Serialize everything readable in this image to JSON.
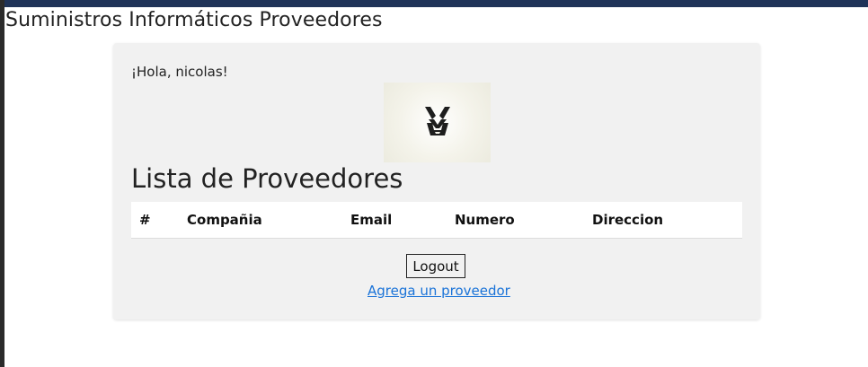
{
  "header": {
    "title": "Suministros Informáticos Proveedores"
  },
  "panel": {
    "greeting": "¡Hola, nicolas!",
    "list_title": "Lista de Proveedores",
    "table": {
      "columns": [
        "#",
        "Compañia",
        "Email",
        "Numero",
        "Direccion"
      ]
    },
    "logout_label": "Logout",
    "add_link_label": "Agrega un proveedor"
  },
  "colors": {
    "topbar": "#1f3358",
    "panel": "#f1f1f1",
    "link": "#1a73d8"
  }
}
